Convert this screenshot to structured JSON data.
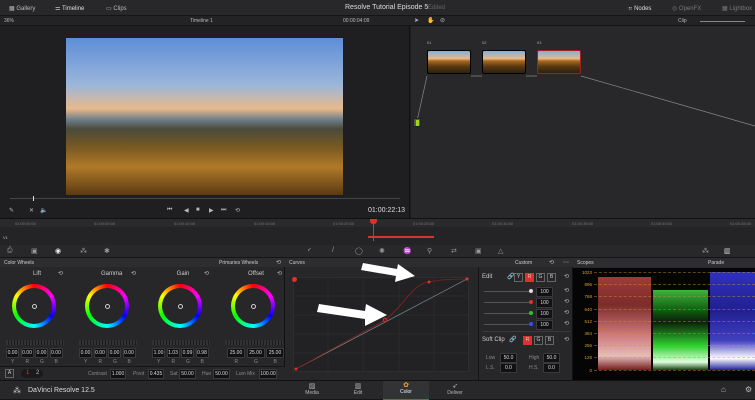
{
  "topbar": {
    "gallery": "Gallery",
    "timeline": "Timeline",
    "clips": "Clips",
    "project_title": "Resolve Tutorial Episode 5",
    "status": "Edited",
    "nodes": "Nodes",
    "openfx": "OpenFX",
    "lightbox": "Lightbox"
  },
  "viewer": {
    "zoom": "36%",
    "timeline_name": "Timeline 1",
    "source_timecode": "00:00:04:09",
    "timecode": "01:00:22:13",
    "progress": 0.08
  },
  "node_editor": {
    "mode": "Clip",
    "nodes": [
      {
        "label": "01"
      },
      {
        "label": "02"
      },
      {
        "label": "03"
      }
    ]
  },
  "timeline": {
    "track": "V1",
    "ticks": [
      "01:00:00:00",
      "01:00:05:00",
      "01:00:10:00",
      "01:00:15:00",
      "01:00:20:00",
      "01:00:25:00",
      "01:00:30:00",
      "01:00:35:00",
      "01:00:40:00",
      "01:00:45:00"
    ]
  },
  "color_wheels": {
    "title": "Color Wheels",
    "mode": "Primaries Wheels",
    "wheels": [
      {
        "name": "Lift",
        "values": [
          "0.00",
          "0.00",
          "0.00",
          "0.00"
        ],
        "channels": [
          "Y",
          "R",
          "G",
          "B"
        ]
      },
      {
        "name": "Gamma",
        "values": [
          "0.00",
          "0.00",
          "0.00",
          "0.00"
        ],
        "channels": [
          "Y",
          "R",
          "G",
          "B"
        ]
      },
      {
        "name": "Gain",
        "values": [
          "1.00",
          "1.03",
          "0.99",
          "0.98"
        ],
        "channels": [
          "Y",
          "R",
          "G",
          "B"
        ]
      },
      {
        "name": "Offset",
        "values": [
          "25.00",
          "25.00",
          "25.00"
        ],
        "channels": [
          "R",
          "G",
          "B"
        ]
      }
    ],
    "auto": "A",
    "page1": "1",
    "page2": "2",
    "contrast_label": "Contrast",
    "contrast": "1.000",
    "pivot_label": "Pivot",
    "pivot": "0.435",
    "sat_label": "Sat",
    "sat": "50.00",
    "hue_label": "Hue",
    "hue": "50.00",
    "lummix_label": "Lum Mix",
    "lummix": "100.00"
  },
  "curves": {
    "title": "Curves",
    "mode": "Custom",
    "edit_label": "Edit",
    "channels": [
      "Y",
      "R",
      "G",
      "B"
    ],
    "intensities": [
      "100",
      "100",
      "100",
      "100"
    ],
    "soft_clip": "Soft Clip",
    "low_label": "Low",
    "low": "50.0",
    "high_label": "High",
    "high": "50.0",
    "ls_label": "L.S.",
    "ls": "0.0",
    "hs_label": "H.S.",
    "hs": "0.0"
  },
  "scopes": {
    "title": "Scopes",
    "mode": "Parade",
    "ticks": [
      "1023",
      "896",
      "768",
      "640",
      "512",
      "384",
      "256",
      "128",
      "0"
    ]
  },
  "bottom": {
    "app_name": "DaVinci Resolve 12.5",
    "pages": [
      "Media",
      "Edit",
      "Color",
      "Deliver"
    ],
    "active_page": "Color"
  },
  "colors": {
    "accent": "#e0302a",
    "node_green": "#9ed61a"
  }
}
